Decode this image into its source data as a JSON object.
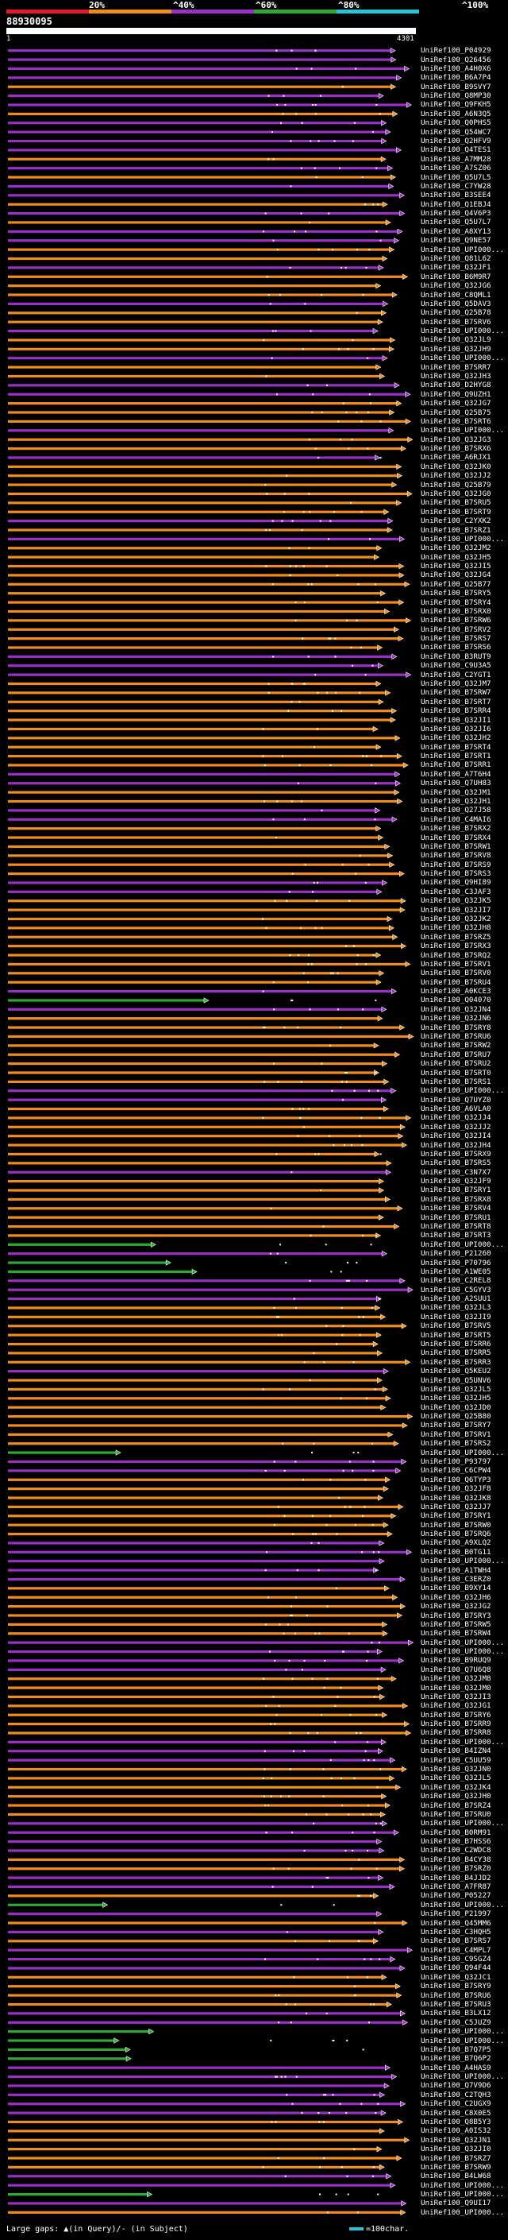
{
  "query": {
    "label": "88930095",
    "ruler_start": "1",
    "ruler_end": "4301"
  },
  "legend": {
    "percent_labels": [
      "20%",
      "^40%",
      "^60%",
      "^80%",
      "^100%"
    ],
    "colors": [
      "#e5182c",
      "#f28b1d",
      "#9b30c9",
      "#2ea836",
      "#26c6da"
    ]
  },
  "hits": [
    {
      "acc": "UniRef100_P04929",
      "color": "#9b30c9"
    },
    {
      "acc": "UniRef100_Q26456",
      "color": "#9b30c9"
    },
    {
      "acc": "UniRef100_A4H0X6",
      "color": "#9b30c9"
    },
    {
      "acc": "UniRef100_B6A7P4",
      "color": "#9b30c9"
    },
    {
      "acc": "UniRef100_B9SVY7",
      "color": "#f28b1d"
    },
    {
      "acc": "UniRef100_Q8MP30",
      "color": "#9b30c9"
    },
    {
      "acc": "UniRef100_Q9FKH5",
      "color": "#9b30c9"
    },
    {
      "acc": "UniRef100_A6N3Q5",
      "color": "#f28b1d"
    },
    {
      "acc": "UniRef100_Q0PHS5",
      "color": "#9b30c9"
    },
    {
      "acc": "UniRef100_Q54WC7",
      "color": "#9b30c9"
    },
    {
      "acc": "UniRef100_Q2HFV9",
      "color": "#9b30c9"
    },
    {
      "acc": "UniRef100_Q4TES1",
      "color": "#9b30c9"
    },
    {
      "acc": "UniRef100_A7MM28",
      "color": "#f28b1d"
    },
    {
      "acc": "UniRef100_A7SZ06",
      "color": "#9b30c9"
    },
    {
      "acc": "UniRef100_Q5U7L5",
      "color": "#f28b1d"
    },
    {
      "acc": "UniRef100_C7YW28",
      "color": "#9b30c9"
    },
    {
      "acc": "UniRef100_B3SEE4",
      "color": "#9b30c9"
    },
    {
      "acc": "UniRef100_Q1EBJ4",
      "color": "#f28b1d"
    },
    {
      "acc": "UniRef100_Q4V6P3",
      "color": "#9b30c9"
    },
    {
      "acc": "UniRef100_Q5U7L7",
      "color": "#f28b1d"
    },
    {
      "acc": "UniRef100_A8XY13",
      "color": "#9b30c9"
    },
    {
      "acc": "UniRef100_Q9NE57",
      "color": "#9b30c9"
    },
    {
      "acc": "UniRef100_UPI000...",
      "color": "#f28b1d"
    },
    {
      "acc": "UniRef100_Q81L62",
      "color": "#f28b1d"
    },
    {
      "acc": "UniRef100_Q32JF1",
      "color": "#9b30c9"
    },
    {
      "acc": "UniRef100_B6M9R7",
      "color": "#f28b1d"
    },
    {
      "acc": "UniRef100_Q32JG6",
      "color": "#f28b1d"
    },
    {
      "acc": "UniRef100_C8QML1",
      "color": "#f28b1d"
    },
    {
      "acc": "UniRef100_Q5DAV3",
      "color": "#9b30c9"
    },
    {
      "acc": "UniRef100_Q25B78",
      "color": "#f28b1d"
    },
    {
      "acc": "UniRef100_B7SRV6",
      "color": "#f28b1d"
    },
    {
      "acc": "UniRef100_UPI000...",
      "color": "#9b30c9"
    },
    {
      "acc": "UniRef100_Q32JL9",
      "color": "#f28b1d"
    },
    {
      "acc": "UniRef100_Q32JH9",
      "color": "#f28b1d"
    },
    {
      "acc": "UniRef100_UPI000...",
      "color": "#9b30c9"
    },
    {
      "acc": "UniRef100_B7SRR7",
      "color": "#f28b1d"
    },
    {
      "acc": "UniRef100_Q32JH3",
      "color": "#f28b1d"
    },
    {
      "acc": "UniRef100_D2HYG8",
      "color": "#9b30c9"
    },
    {
      "acc": "UniRef100_Q9UZH1",
      "color": "#9b30c9"
    },
    {
      "acc": "UniRef100_Q32JG7",
      "color": "#f28b1d"
    },
    {
      "acc": "UniRef100_Q25B75",
      "color": "#f28b1d"
    },
    {
      "acc": "UniRef100_B7SRT6",
      "color": "#f28b1d"
    },
    {
      "acc": "UniRef100_UPI000...",
      "color": "#9b30c9"
    },
    {
      "acc": "UniRef100_Q32JG3",
      "color": "#f28b1d"
    },
    {
      "acc": "UniRef100_B7SRX6",
      "color": "#f28b1d"
    },
    {
      "acc": "UniRef100_A6RJX1",
      "color": "#9b30c9"
    },
    {
      "acc": "UniRef100_Q32JK0",
      "color": "#f28b1d"
    },
    {
      "acc": "UniRef100_Q32JJ2",
      "color": "#f28b1d"
    },
    {
      "acc": "UniRef100_Q25B79",
      "color": "#f28b1d"
    },
    {
      "acc": "UniRef100_Q32JG0",
      "color": "#f28b1d"
    },
    {
      "acc": "UniRef100_B7SRU5",
      "color": "#f28b1d"
    },
    {
      "acc": "UniRef100_B7SRT9",
      "color": "#f28b1d"
    },
    {
      "acc": "UniRef100_C2YXK2",
      "color": "#9b30c9"
    },
    {
      "acc": "UniRef100_B7SRZ1",
      "color": "#f28b1d"
    },
    {
      "acc": "UniRef100_UPI000...",
      "color": "#9b30c9"
    },
    {
      "acc": "UniRef100_Q32JM2",
      "color": "#f28b1d"
    },
    {
      "acc": "UniRef100_Q32JH5",
      "color": "#f28b1d"
    },
    {
      "acc": "UniRef100_Q32JI5",
      "color": "#f28b1d"
    },
    {
      "acc": "UniRef100_Q32JG4",
      "color": "#f28b1d"
    },
    {
      "acc": "UniRef100_Q25B77",
      "color": "#f28b1d"
    },
    {
      "acc": "UniRef100_B7SRY5",
      "color": "#f28b1d"
    },
    {
      "acc": "UniRef100_B7SRY4",
      "color": "#f28b1d"
    },
    {
      "acc": "UniRef100_B7SRX0",
      "color": "#f28b1d"
    },
    {
      "acc": "UniRef100_B7SRW6",
      "color": "#f28b1d"
    },
    {
      "acc": "UniRef100_B7SRV2",
      "color": "#f28b1d"
    },
    {
      "acc": "UniRef100_B7SRS7",
      "color": "#f28b1d"
    },
    {
      "acc": "UniRef100_B7SRS6",
      "color": "#f28b1d"
    },
    {
      "acc": "UniRef100_B3RUT9",
      "color": "#9b30c9"
    },
    {
      "acc": "UniRef100_C9U3A5",
      "color": "#9b30c9"
    },
    {
      "acc": "UniRef100_C2YGT1",
      "color": "#9b30c9"
    },
    {
      "acc": "UniRef100_Q32JM7",
      "color": "#f28b1d"
    },
    {
      "acc": "UniRef100_B7SRW7",
      "color": "#f28b1d"
    },
    {
      "acc": "UniRef100_B7SRT7",
      "color": "#f28b1d"
    },
    {
      "acc": "UniRef100_B7SRR4",
      "color": "#f28b1d"
    },
    {
      "acc": "UniRef100_Q32JI1",
      "color": "#f28b1d"
    },
    {
      "acc": "UniRef100_Q32JI6",
      "color": "#f28b1d"
    },
    {
      "acc": "UniRef100_Q32JH2",
      "color": "#f28b1d"
    },
    {
      "acc": "UniRef100_B7SRT4",
      "color": "#f28b1d"
    },
    {
      "acc": "UniRef100_B7SRT1",
      "color": "#f28b1d"
    },
    {
      "acc": "UniRef100_B7SRR1",
      "color": "#f28b1d"
    },
    {
      "acc": "UniRef100_A7T6H4",
      "color": "#9b30c9"
    },
    {
      "acc": "UniRef100_Q7UH83",
      "color": "#9b30c9"
    },
    {
      "acc": "UniRef100_Q32JM1",
      "color": "#f28b1d"
    },
    {
      "acc": "UniRef100_Q32JH1",
      "color": "#f28b1d"
    },
    {
      "acc": "UniRef100_Q27J58",
      "color": "#9b30c9"
    },
    {
      "acc": "UniRef100_C4MAI6",
      "color": "#9b30c9"
    },
    {
      "acc": "UniRef100_B7SRX2",
      "color": "#f28b1d"
    },
    {
      "acc": "UniRef100_B7SRX4",
      "color": "#f28b1d"
    },
    {
      "acc": "UniRef100_B7SRW1",
      "color": "#f28b1d"
    },
    {
      "acc": "UniRef100_B7SRV8",
      "color": "#f28b1d"
    },
    {
      "acc": "UniRef100_B7SRS9",
      "color": "#f28b1d"
    },
    {
      "acc": "UniRef100_B7SRS3",
      "color": "#f28b1d"
    },
    {
      "acc": "UniRef100_Q9HI89",
      "color": "#9b30c9"
    },
    {
      "acc": "UniRef100_C3JAF3",
      "color": "#9b30c9"
    },
    {
      "acc": "UniRef100_Q32JK5",
      "color": "#f28b1d"
    },
    {
      "acc": "UniRef100_Q32JI7",
      "color": "#f28b1d"
    },
    {
      "acc": "UniRef100_Q32JK2",
      "color": "#f28b1d"
    },
    {
      "acc": "UniRef100_Q32JH8",
      "color": "#f28b1d"
    },
    {
      "acc": "UniRef100_B7SRZ5",
      "color": "#f28b1d"
    },
    {
      "acc": "UniRef100_B7SRX3",
      "color": "#f28b1d"
    },
    {
      "acc": "UniRef100_B7SRQ2",
      "color": "#f28b1d"
    },
    {
      "acc": "UniRef100_B7SRV1",
      "color": "#f28b1d"
    },
    {
      "acc": "UniRef100_B7SRV0",
      "color": "#f28b1d"
    },
    {
      "acc": "UniRef100_B7SRU4",
      "color": "#f28b1d"
    },
    {
      "acc": "UniRef100_A0KCE3",
      "color": "#9b30c9"
    },
    {
      "acc": "UniRef100_Q04070",
      "color": "#2ea836"
    },
    {
      "acc": "UniRef100_Q32JN4",
      "color": "#9b30c9"
    },
    {
      "acc": "UniRef100_Q32JN6",
      "color": "#f28b1d"
    },
    {
      "acc": "UniRef100_B7SRY8",
      "color": "#f28b1d"
    },
    {
      "acc": "UniRef100_B7SRU6",
      "color": "#f28b1d"
    },
    {
      "acc": "UniRef100_B7SRW2",
      "color": "#f28b1d"
    },
    {
      "acc": "UniRef100_B7SRU7",
      "color": "#f28b1d"
    },
    {
      "acc": "UniRef100_B7SRU2",
      "color": "#f28b1d"
    },
    {
      "acc": "UniRef100_B7SRT0",
      "color": "#f28b1d"
    },
    {
      "acc": "UniRef100_B7SRS1",
      "color": "#f28b1d"
    },
    {
      "acc": "UniRef100_UPI000...",
      "color": "#9b30c9"
    },
    {
      "acc": "UniRef100_Q7UYZ0",
      "color": "#9b30c9"
    },
    {
      "acc": "UniRef100_A6VLA0",
      "color": "#f28b1d"
    },
    {
      "acc": "UniRef100_Q32JJ4",
      "color": "#f28b1d"
    },
    {
      "acc": "UniRef100_Q32JJ2",
      "color": "#f28b1d"
    },
    {
      "acc": "UniRef100_Q32JI4",
      "color": "#f28b1d"
    },
    {
      "acc": "UniRef100_Q32JH4",
      "color": "#f28b1d"
    },
    {
      "acc": "UniRef100_B7SRX9",
      "color": "#f28b1d"
    },
    {
      "acc": "UniRef100_B7SRS5",
      "color": "#f28b1d"
    },
    {
      "acc": "UniRef100_C3N7X7",
      "color": "#9b30c9"
    },
    {
      "acc": "UniRef100_Q32JF9",
      "color": "#f28b1d"
    },
    {
      "acc": "UniRef100_B7SRY1",
      "color": "#f28b1d"
    },
    {
      "acc": "UniRef100_B7SRX8",
      "color": "#f28b1d"
    },
    {
      "acc": "UniRef100_B7SRV4",
      "color": "#f28b1d"
    },
    {
      "acc": "UniRef100_B7SRU1",
      "color": "#f28b1d"
    },
    {
      "acc": "UniRef100_B7SRT8",
      "color": "#f28b1d"
    },
    {
      "acc": "UniRef100_B7SRT3",
      "color": "#f28b1d"
    },
    {
      "acc": "UniRef100_UPI000...",
      "color": "#2ea836"
    },
    {
      "acc": "UniRef100_P21260",
      "color": "#9b30c9"
    },
    {
      "acc": "UniRef100_P70796",
      "color": "#2ea836"
    },
    {
      "acc": "UniRef100_A1WE05",
      "color": "#2ea836"
    },
    {
      "acc": "UniRef100_C2REL8",
      "color": "#9b30c9"
    },
    {
      "acc": "UniRef100_C5GYV3",
      "color": "#9b30c9"
    },
    {
      "acc": "UniRef100_A2SUU1",
      "color": "#9b30c9"
    },
    {
      "acc": "UniRef100_Q32JL3",
      "color": "#f28b1d"
    },
    {
      "acc": "UniRef100_Q32JI9",
      "color": "#f28b1d"
    },
    {
      "acc": "UniRef100_B7SRV5",
      "color": "#f28b1d"
    },
    {
      "acc": "UniRef100_B7SRT5",
      "color": "#f28b1d"
    },
    {
      "acc": "UniRef100_B7SRR6",
      "color": "#f28b1d"
    },
    {
      "acc": "UniRef100_B7SRR5",
      "color": "#f28b1d"
    },
    {
      "acc": "UniRef100_B7SRR3",
      "color": "#f28b1d"
    },
    {
      "acc": "UniRef100_Q5KEU2",
      "color": "#9b30c9"
    },
    {
      "acc": "UniRef100_Q5UNV6",
      "color": "#f28b1d"
    },
    {
      "acc": "UniRef100_Q32JL5",
      "color": "#f28b1d"
    },
    {
      "acc": "UniRef100_Q32JH5",
      "color": "#f28b1d"
    },
    {
      "acc": "UniRef100_Q32JD0",
      "color": "#f28b1d"
    },
    {
      "acc": "UniRef100_Q25B80",
      "color": "#f28b1d"
    },
    {
      "acc": "UniRef100_B7SRY7",
      "color": "#f28b1d"
    },
    {
      "acc": "UniRef100_B7SRV1",
      "color": "#f28b1d"
    },
    {
      "acc": "UniRef100_B7SRS2",
      "color": "#f28b1d"
    },
    {
      "acc": "UniRef100_UPI000...",
      "color": "#2ea836"
    },
    {
      "acc": "UniRef100_P93797",
      "color": "#9b30c9"
    },
    {
      "acc": "UniRef100_C6CPW4",
      "color": "#9b30c9"
    },
    {
      "acc": "UniRef100_Q6TYP3",
      "color": "#f28b1d"
    },
    {
      "acc": "UniRef100_Q32JF8",
      "color": "#f28b1d"
    },
    {
      "acc": "UniRef100_Q32JK8",
      "color": "#f28b1d"
    },
    {
      "acc": "UniRef100_Q32JJ7",
      "color": "#f28b1d"
    },
    {
      "acc": "UniRef100_B7SRY1",
      "color": "#f28b1d"
    },
    {
      "acc": "UniRef100_B7SRW0",
      "color": "#f28b1d"
    },
    {
      "acc": "UniRef100_B7SRQ6",
      "color": "#f28b1d"
    },
    {
      "acc": "UniRef100_A9XLQ2",
      "color": "#9b30c9"
    },
    {
      "acc": "UniRef100_B0TG11",
      "color": "#9b30c9"
    },
    {
      "acc": "UniRef100_UPI000...",
      "color": "#9b30c9"
    },
    {
      "acc": "UniRef100_A1TWH4",
      "color": "#9b30c9"
    },
    {
      "acc": "UniRef100_C3ERZ0",
      "color": "#9b30c9"
    },
    {
      "acc": "UniRef100_B9XY14",
      "color": "#f28b1d"
    },
    {
      "acc": "UniRef100_Q32JH6",
      "color": "#f28b1d"
    },
    {
      "acc": "UniRef100_Q32JG2",
      "color": "#f28b1d"
    },
    {
      "acc": "UniRef100_B7SRY3",
      "color": "#f28b1d"
    },
    {
      "acc": "UniRef100_B7SRW5",
      "color": "#f28b1d"
    },
    {
      "acc": "UniRef100_B7SRW4",
      "color": "#f28b1d"
    },
    {
      "acc": "UniRef100_UPI000...",
      "color": "#9b30c9"
    },
    {
      "acc": "UniRef100_UPI000...",
      "color": "#9b30c9"
    },
    {
      "acc": "UniRef100_B9RUQ9",
      "color": "#9b30c9"
    },
    {
      "acc": "UniRef100_Q7U6Q8",
      "color": "#9b30c9"
    },
    {
      "acc": "UniRef100_Q32JM8",
      "color": "#f28b1d"
    },
    {
      "acc": "UniRef100_Q32JM0",
      "color": "#f28b1d"
    },
    {
      "acc": "UniRef100_Q32JI3",
      "color": "#f28b1d"
    },
    {
      "acc": "UniRef100_Q32JG1",
      "color": "#f28b1d"
    },
    {
      "acc": "UniRef100_B7SRY6",
      "color": "#f28b1d"
    },
    {
      "acc": "UniRef100_B7SRR9",
      "color": "#f28b1d"
    },
    {
      "acc": "UniRef100_B7SRR8",
      "color": "#f28b1d"
    },
    {
      "acc": "UniRef100_UPI000...",
      "color": "#9b30c9"
    },
    {
      "acc": "UniRef100_B4IZN4",
      "color": "#9b30c9"
    },
    {
      "acc": "UniRef100_C5UU59",
      "color": "#9b30c9"
    },
    {
      "acc": "UniRef100_Q32JN0",
      "color": "#f28b1d"
    },
    {
      "acc": "UniRef100_Q32JL5",
      "color": "#f28b1d"
    },
    {
      "acc": "UniRef100_Q32JK4",
      "color": "#f28b1d"
    },
    {
      "acc": "UniRef100_Q32JH0",
      "color": "#f28b1d"
    },
    {
      "acc": "UniRef100_B7SRZ4",
      "color": "#f28b1d"
    },
    {
      "acc": "UniRef100_B7SRU0",
      "color": "#f28b1d"
    },
    {
      "acc": "UniRef100_UPI000...",
      "color": "#9b30c9"
    },
    {
      "acc": "UniRef100_B0RM91",
      "color": "#9b30c9"
    },
    {
      "acc": "UniRef100_B7HSS6",
      "color": "#9b30c9"
    },
    {
      "acc": "UniRef100_C2WDC8",
      "color": "#9b30c9"
    },
    {
      "acc": "UniRef100_B4CY38",
      "color": "#f28b1d"
    },
    {
      "acc": "UniRef100_B7SRZ0",
      "color": "#f28b1d"
    },
    {
      "acc": "UniRef100_B4JJD2",
      "color": "#9b30c9"
    },
    {
      "acc": "UniRef100_A7FR87",
      "color": "#9b30c9"
    },
    {
      "acc": "UniRef100_P05227",
      "color": "#f28b1d"
    },
    {
      "acc": "UniRef100_UPI000...",
      "color": "#2ea836"
    },
    {
      "acc": "UniRef100_P21997",
      "color": "#9b30c9"
    },
    {
      "acc": "UniRef100_Q45MM6",
      "color": "#f28b1d"
    },
    {
      "acc": "UniRef100_C3HQH5",
      "color": "#9b30c9"
    },
    {
      "acc": "UniRef100_B7SRS7",
      "color": "#f28b1d"
    },
    {
      "acc": "UniRef100_C4MPL7",
      "color": "#9b30c9"
    },
    {
      "acc": "UniRef100_C9SGZ4",
      "color": "#9b30c9"
    },
    {
      "acc": "UniRef100_Q94F44",
      "color": "#9b30c9"
    },
    {
      "acc": "UniRef100_Q32JC1",
      "color": "#f28b1d"
    },
    {
      "acc": "UniRef100_B7SRY9",
      "color": "#f28b1d"
    },
    {
      "acc": "UniRef100_B7SRU6",
      "color": "#f28b1d"
    },
    {
      "acc": "UniRef100_B7SRU3",
      "color": "#f28b1d"
    },
    {
      "acc": "UniRef100_B3LX12",
      "color": "#9b30c9"
    },
    {
      "acc": "UniRef100_C5JUZ9",
      "color": "#9b30c9"
    },
    {
      "acc": "UniRef100_UPI000...",
      "color": "#2ea836"
    },
    {
      "acc": "UniRef100_UPI000...",
      "color": "#2ea836"
    },
    {
      "acc": "UniRef100_B7Q7P5",
      "color": "#2ea836"
    },
    {
      "acc": "UniRef100_B7Q6P2",
      "color": "#2ea836"
    },
    {
      "acc": "UniRef100_A4HAS9",
      "color": "#9b30c9"
    },
    {
      "acc": "UniRef100_UPI000...",
      "color": "#9b30c9"
    },
    {
      "acc": "UniRef100_Q7V9D6",
      "color": "#9b30c9"
    },
    {
      "acc": "UniRef100_C2TQH3",
      "color": "#9b30c9"
    },
    {
      "acc": "UniRef100_C2UGX9",
      "color": "#9b30c9"
    },
    {
      "acc": "UniRef100_C8X0E5",
      "color": "#9b30c9"
    },
    {
      "acc": "UniRef100_Q8B5Y3",
      "color": "#f28b1d"
    },
    {
      "acc": "UniRef100_A0IS32",
      "color": "#f28b1d"
    },
    {
      "acc": "UniRef100_Q32JN1",
      "color": "#f28b1d"
    },
    {
      "acc": "UniRef100_Q32JI0",
      "color": "#f28b1d"
    },
    {
      "acc": "UniRef100_B7SRZ7",
      "color": "#f28b1d"
    },
    {
      "acc": "UniRef100_B7SRW9",
      "color": "#f28b1d"
    },
    {
      "acc": "UniRef100_B4LW68",
      "color": "#9b30c9"
    },
    {
      "acc": "UniRef100_UPI000...",
      "color": "#9b30c9"
    },
    {
      "acc": "UniRef100_UPI000...",
      "color": "#2ea836"
    },
    {
      "acc": "UniRef100_Q9UI17",
      "color": "#9b30c9"
    },
    {
      "acc": "UniRef100_UPI000...",
      "color": "#f28b1d"
    }
  ],
  "footer": {
    "left": "Large gaps: ▲(in Query)/- (in Subject)",
    "right": "=100char."
  }
}
